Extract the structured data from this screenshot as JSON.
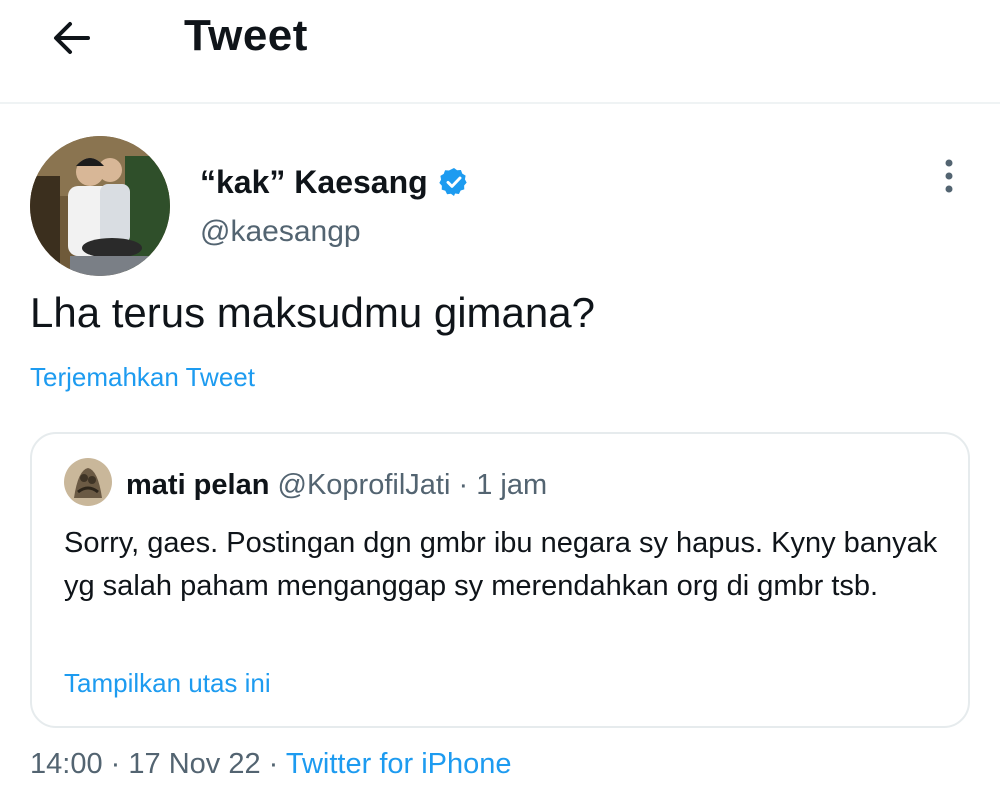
{
  "header": {
    "back_icon": "arrow-left-icon",
    "title": "Tweet"
  },
  "tweet": {
    "avatar_icon": "profile-photo",
    "display_name": "“kak” Kaesang",
    "verified_icon": "verified-badge-icon",
    "handle": "@kaesangp",
    "more_icon": "more-vertical-icon",
    "text": "Lha terus maksudmu gimana?",
    "translate_label": "Terjemahkan Tweet",
    "time": "14:00",
    "separator": "·",
    "date": "17 Nov 22",
    "source": "Twitter for iPhone"
  },
  "quote": {
    "avatar_icon": "profile-photo",
    "name": "mati pelan",
    "handle": "@KoprofilJati",
    "separator": "·",
    "time": "1 jam",
    "text": "Sorry, gaes. Postingan dgn gmbr ibu negara sy hapus. Kyny banyak yg salah paham menganggap sy merendahkan org di gmbr tsb.",
    "show_thread_label": "Tampilkan utas ini"
  },
  "colors": {
    "link": "#1d9bf0",
    "secondary_text": "#536471",
    "border": "#e6ebed"
  }
}
